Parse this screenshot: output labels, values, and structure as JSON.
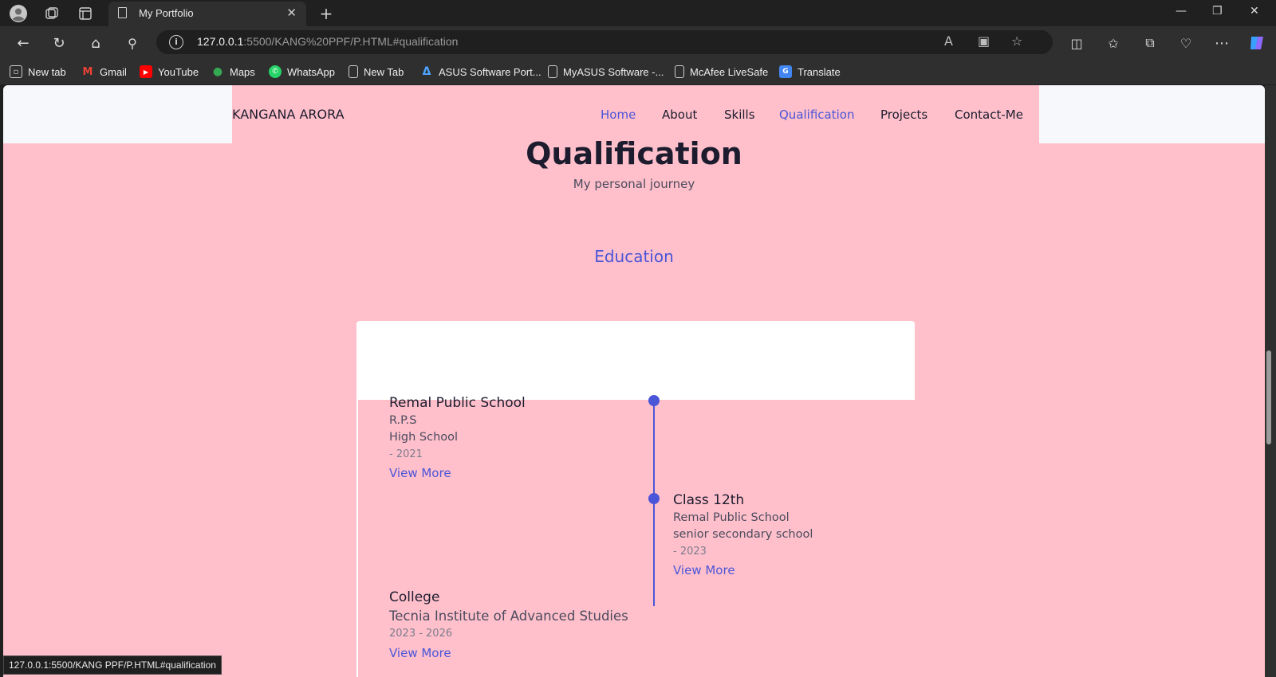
{
  "browser": {
    "tab_title": "My Portfolio",
    "url_host": "127.0.0.1",
    "url_rest": ":5500/KANG%20PPF/P.HTML#qualification",
    "status_text": "127.0.0.1:5500/KANG PPF/P.HTML#qualification",
    "bookmarks": [
      {
        "label": "New tab",
        "icon": "new-tab-icon"
      },
      {
        "label": "Gmail",
        "icon": "gmail-icon",
        "color": "#ea4335"
      },
      {
        "label": "YouTube",
        "icon": "youtube-icon",
        "color": "#ff0000"
      },
      {
        "label": "Maps",
        "icon": "maps-icon",
        "color": "#34a853"
      },
      {
        "label": "WhatsApp",
        "icon": "whatsapp-icon",
        "color": "#25d366"
      },
      {
        "label": "New Tab",
        "icon": "page-icon"
      },
      {
        "label": "ASUS Software Port...",
        "icon": "asus-icon",
        "color": "#4da3ff"
      },
      {
        "label": "MyASUS Software -...",
        "icon": "page-icon"
      },
      {
        "label": "McAfee LiveSafe",
        "icon": "page-icon"
      },
      {
        "label": "Translate",
        "icon": "translate-icon",
        "color": "#4285f4"
      }
    ]
  },
  "site": {
    "logo": "KANGANA ARORA",
    "nav": [
      {
        "label": "Home",
        "active": true
      },
      {
        "label": "About"
      },
      {
        "label": "Skills"
      },
      {
        "label": "Qualification",
        "active": true
      },
      {
        "label": "Projects"
      },
      {
        "label": "Contact-Me"
      }
    ],
    "accent_color": "#4b55d8",
    "background_color": "#ffc0cb"
  },
  "qualification": {
    "title": "Qualification",
    "subtitle": "My personal journey",
    "tab": "Education",
    "items": [
      {
        "title": "Remal Public School",
        "line1": "R.P.S",
        "line2": "High School",
        "date": "- 2021",
        "link": "View More"
      },
      {
        "title": "Class 12th",
        "line1": "Remal Public School",
        "line2": "senior secondary school",
        "date": "- 2023",
        "link": "View More"
      },
      {
        "title": "College",
        "line1": "Tecnia Institute of Advanced Studies",
        "date": "2023 - 2026",
        "link": "View More"
      }
    ]
  }
}
